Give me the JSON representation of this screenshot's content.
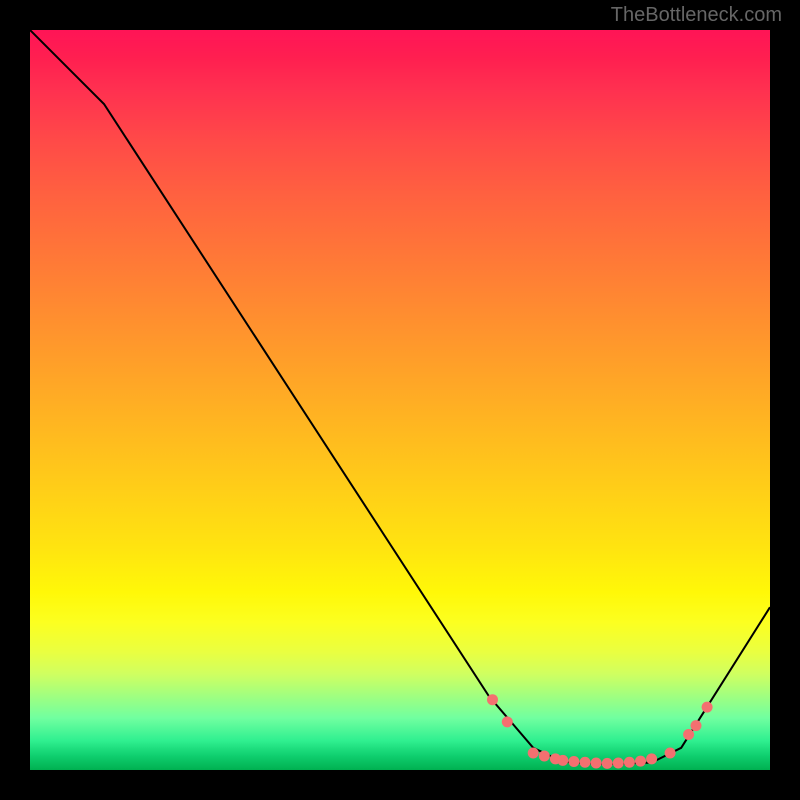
{
  "attribution": "TheBottleneck.com",
  "chart_data": {
    "type": "line",
    "title": "",
    "xlabel": "",
    "ylabel": "",
    "xlim": [
      0,
      100
    ],
    "ylim": [
      0,
      100
    ],
    "curve": [
      {
        "x": 0,
        "y": 100
      },
      {
        "x": 6,
        "y": 94
      },
      {
        "x": 10,
        "y": 90
      },
      {
        "x": 62,
        "y": 10
      },
      {
        "x": 68,
        "y": 3
      },
      {
        "x": 72,
        "y": 1.1
      },
      {
        "x": 78,
        "y": 0.8
      },
      {
        "x": 84,
        "y": 1.0
      },
      {
        "x": 88,
        "y": 3
      },
      {
        "x": 100,
        "y": 22
      }
    ],
    "recommended_band_points": [
      {
        "x": 62.5,
        "y": 9.5
      },
      {
        "x": 64.5,
        "y": 6.5
      },
      {
        "x": 68.0,
        "y": 2.3
      },
      {
        "x": 69.5,
        "y": 1.9
      },
      {
        "x": 71.0,
        "y": 1.5
      },
      {
        "x": 72.0,
        "y": 1.3
      },
      {
        "x": 73.5,
        "y": 1.15
      },
      {
        "x": 75.0,
        "y": 1.05
      },
      {
        "x": 76.5,
        "y": 0.95
      },
      {
        "x": 78.0,
        "y": 0.9
      },
      {
        "x": 79.5,
        "y": 0.95
      },
      {
        "x": 81.0,
        "y": 1.05
      },
      {
        "x": 82.5,
        "y": 1.2
      },
      {
        "x": 84.0,
        "y": 1.5
      },
      {
        "x": 86.5,
        "y": 2.3
      },
      {
        "x": 89.0,
        "y": 4.8
      },
      {
        "x": 90.0,
        "y": 6.0
      },
      {
        "x": 91.5,
        "y": 8.5
      }
    ],
    "marker_color": "#f47070",
    "curve_color": "#000000"
  }
}
